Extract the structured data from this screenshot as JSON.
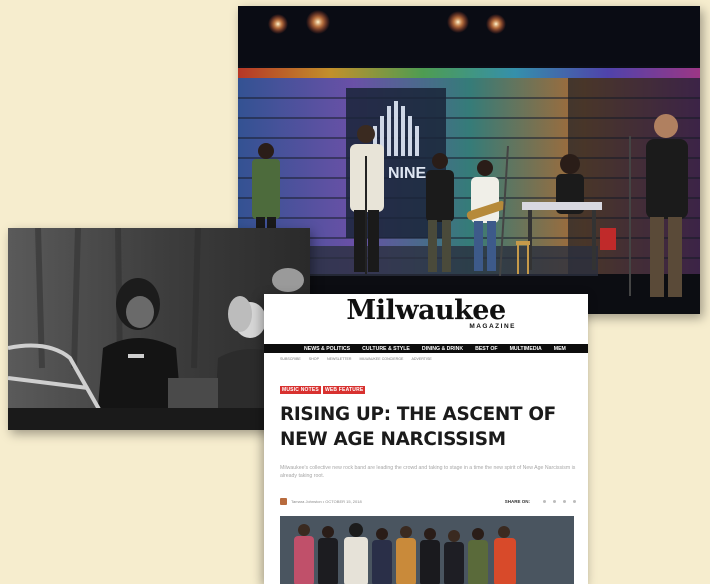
{
  "colors": {
    "page_background": "#f6edce",
    "tag_red": "#d8312f",
    "nav_black": "#0d0d0d"
  },
  "stage_photo": {
    "backdrop_text": "NINE"
  },
  "magazine": {
    "logo": "Milwaukee",
    "logo_sub": "MAGAZINE",
    "nav": [
      "NEWS & POLITICS",
      "CULTURE & STYLE",
      "DINING & DRINK",
      "BEST OF",
      "MULTIMEDIA",
      "MEM"
    ],
    "subnav": [
      "SUBSCRIBE",
      "SHOP",
      "NEWSLETTER",
      "MILWAUKEE CONCIERGE",
      "ADVERTISE"
    ],
    "tags": [
      "MUSIC NOTES",
      "WEB FEATURE"
    ],
    "headline": "RISING UP: THE ASCENT OF NEW AGE NARCISSISM",
    "dek": "Milwaukee's collective new rock band are leading the crowd and taking to stage in a time the new spirit of New Age Narcissism is already taking root.",
    "byline": "Tamara Johnston • OCTOBER 15, 2018",
    "share_label": "SHARE ON:",
    "share_icons": [
      "facebook-icon",
      "twitter-icon",
      "pinterest-icon",
      "email-icon"
    ]
  }
}
